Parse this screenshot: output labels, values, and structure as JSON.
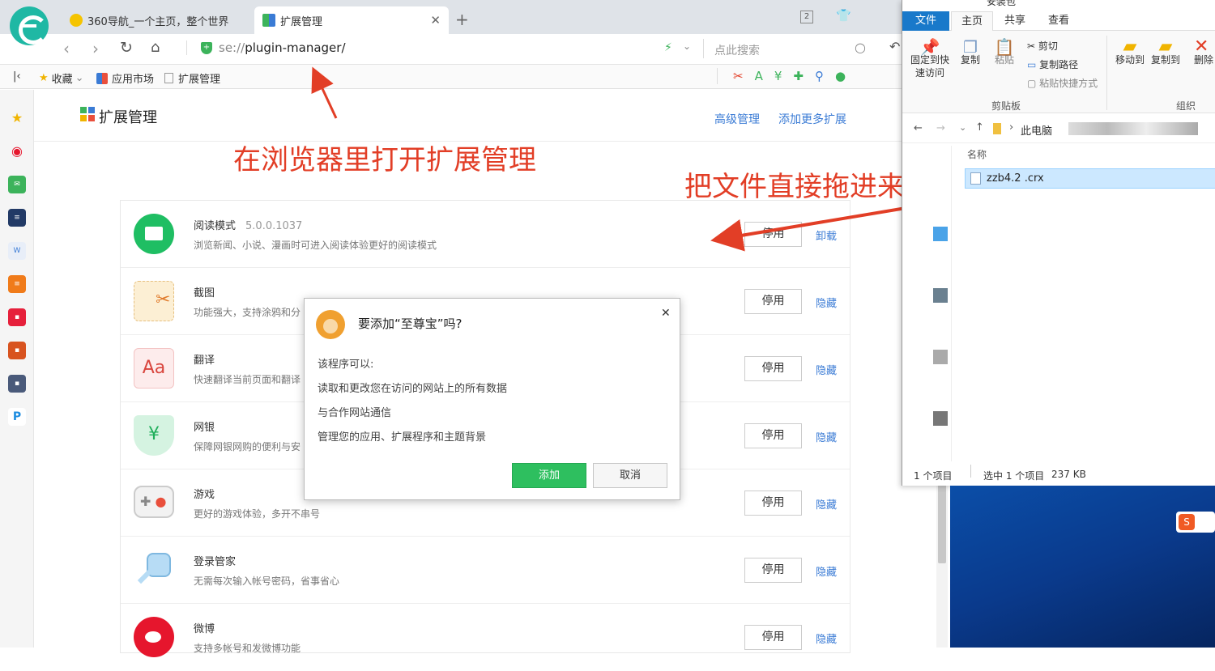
{
  "browser": {
    "tabs": [
      {
        "title": "360导航_一个主页，整个世界"
      },
      {
        "title": "扩展管理"
      }
    ],
    "tab_count": "2",
    "address": {
      "protocol": "se://",
      "path": "plugin-manager/"
    },
    "search_placeholder": "点此搜索",
    "bookmarks": {
      "favorites": "收藏",
      "app_market": "应用市场",
      "ext_manager": "扩展管理"
    }
  },
  "page": {
    "title": "扩展管理",
    "links": {
      "advanced": "高级管理",
      "add_more": "添加更多扩展"
    },
    "extensions": [
      {
        "name": "阅读模式",
        "version": "5.0.0.1037",
        "desc": "浏览新闻、小说、漫画时可进入阅读体验更好的阅读模式",
        "button": "停用",
        "link": "卸载"
      },
      {
        "name": "截图",
        "version": "",
        "desc": "功能强大，支持涂鸦和分",
        "button": "停用",
        "link": "隐藏"
      },
      {
        "name": "翻译",
        "version": "",
        "desc": "快速翻译当前页面和翻译",
        "button": "停用",
        "link": "隐藏"
      },
      {
        "name": "网银",
        "version": "",
        "desc": "保障网银网购的便利与安",
        "button": "停用",
        "link": "隐藏"
      },
      {
        "name": "游戏",
        "version": "",
        "desc": "更好的游戏体验，多开不串号",
        "button": "停用",
        "link": "隐藏"
      },
      {
        "name": "登录管家",
        "version": "",
        "desc": "无需每次输入帐号密码，省事省心",
        "button": "停用",
        "link": "隐藏"
      },
      {
        "name": "微博",
        "version": "",
        "desc": "支持多帐号和发微博功能",
        "button": "停用",
        "link": "隐藏"
      }
    ]
  },
  "dialog": {
    "title": "要添加“至尊宝”吗?",
    "intro": "该程序可以:",
    "permissions": [
      "读取和更改您在访问的网站上的所有数据",
      "与合作网站通信",
      "管理您的应用、扩展程序和主题背景"
    ],
    "add_button": "添加",
    "cancel_button": "取消"
  },
  "annotations": {
    "open_manager": "在浏览器里打开扩展管理",
    "drag_file": "把文件直接拖进来"
  },
  "explorer": {
    "title_fragment": "安装包",
    "tabs": {
      "file": "文件",
      "home": "主页",
      "share": "共享",
      "view": "查看"
    },
    "ribbon": {
      "pin": "固定到快速访问",
      "copy": "复制",
      "paste": "粘贴",
      "cut": "剪切",
      "copy_path": "复制路径",
      "paste_shortcut": "粘贴快捷方式",
      "move_to": "移动到",
      "copy_to": "复制到",
      "delete": "删除",
      "group_clipboard": "剪贴板",
      "group_organize": "组织"
    },
    "path": "此电脑",
    "column_name": "名称",
    "file": "zzb4.2 .crx",
    "status": {
      "items": "1 个项目",
      "selected": "选中 1 个项目",
      "size": "237 KB"
    }
  },
  "colors": {
    "accent_green": "#2ebf5f",
    "link_blue": "#3a7bd5",
    "annotation_red": "#e23e26"
  }
}
